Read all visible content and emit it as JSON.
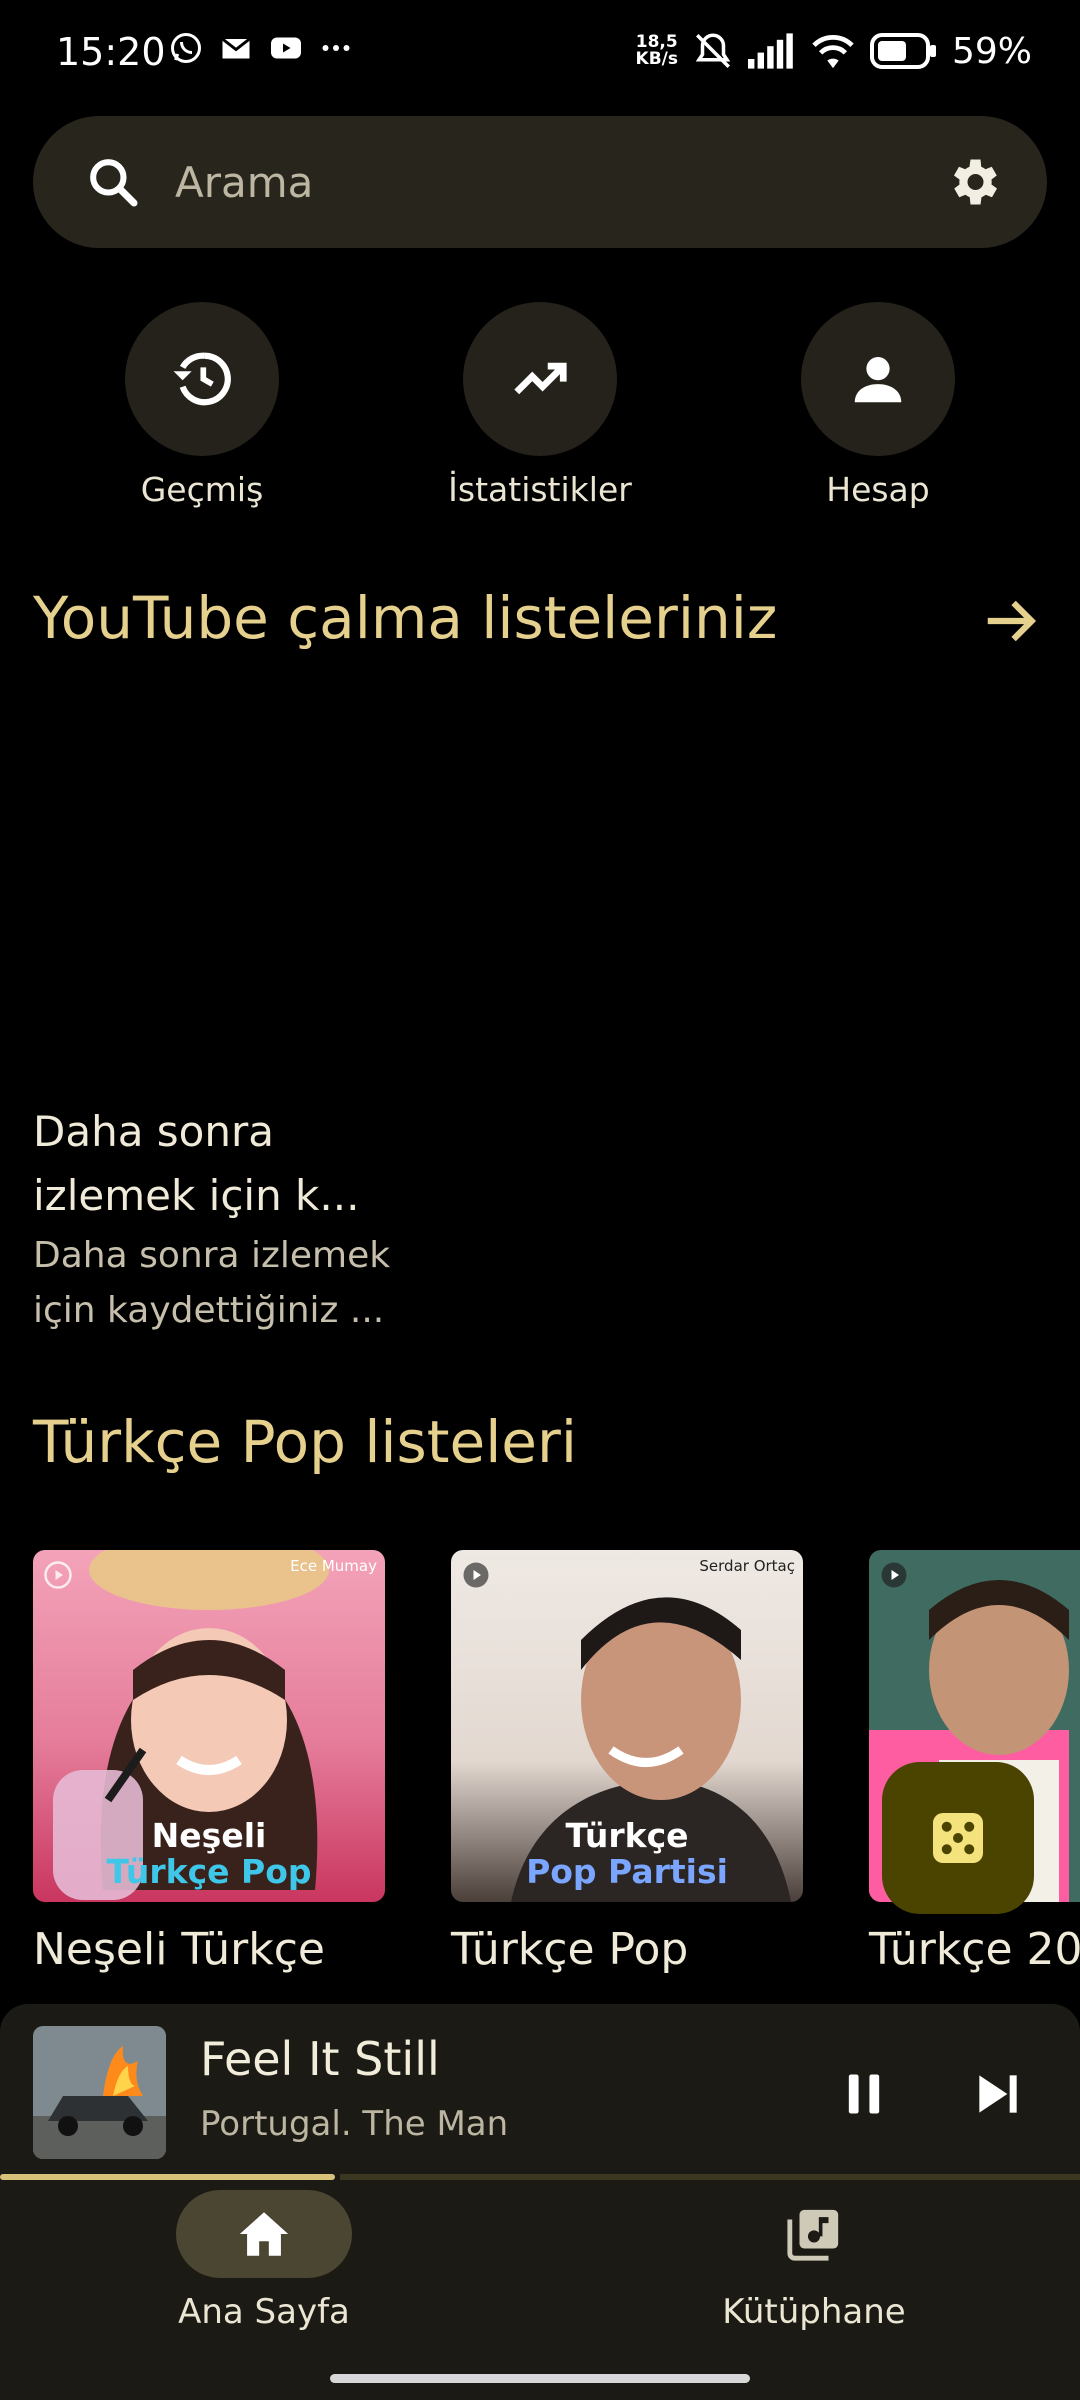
{
  "status": {
    "time": "15:20",
    "speed_value": "18,5",
    "speed_unit": "KB/s",
    "battery": "59%",
    "left_icons": [
      "whatsapp-icon",
      "gmail-icon",
      "youtube-icon",
      "more-dots-icon"
    ]
  },
  "search": {
    "placeholder": "Arama"
  },
  "quick_actions": [
    {
      "label": "Geçmiş",
      "icon": "history-icon"
    },
    {
      "label": "İstatistikler",
      "icon": "trending-icon"
    },
    {
      "label": "Hesap",
      "icon": "account-icon"
    }
  ],
  "youtube_section": {
    "title": "YouTube çalma listeleriniz",
    "watch_later": {
      "title": "Daha sonra izlemek için k...",
      "subtitle": "Daha sonra izlemek için kaydettiğiniz ..."
    }
  },
  "pop_section": {
    "title": "Türkçe Pop listeleri",
    "cards": [
      {
        "title": "Neşeli Türkçe",
        "cover_artist": "Ece Mumay",
        "cover_line1": "Neşeli",
        "cover_line2": "Türkçe Pop",
        "accent": "#3fc7ea"
      },
      {
        "title": "Türkçe Pop",
        "cover_artist": "Serdar Ortaç",
        "cover_line1": "Türkçe",
        "cover_line2": "Pop Partisi",
        "accent": "#7aa6ff"
      },
      {
        "title": "Türkçe 20",
        "cover_artist": "",
        "cover_line1": "",
        "cover_line2": "",
        "accent": "#ff5da2"
      }
    ]
  },
  "now_playing": {
    "title": "Feel It Still",
    "artist": "Portugal. The Man",
    "progress": 0.31
  },
  "nav": {
    "home": "Ana Sayfa",
    "library": "Kütüphane"
  },
  "colors": {
    "accent_gold": "#e6d08e",
    "surface": "#1b1a14",
    "fab": "#4a4400"
  }
}
